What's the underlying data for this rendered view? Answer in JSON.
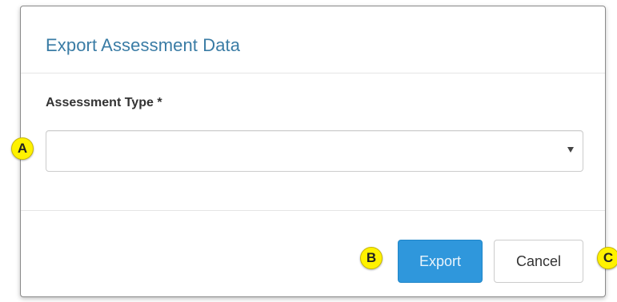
{
  "dialog": {
    "title": "Export Assessment Data",
    "field_label": "Assessment Type *",
    "select": {
      "value": "",
      "icon": "caret-down-icon"
    },
    "export_label": "Export",
    "cancel_label": "Cancel"
  },
  "callouts": {
    "a": "A",
    "b": "B",
    "c": "C"
  },
  "colors": {
    "title": "#3a7ca5",
    "primary_button": "#2f97dc",
    "callout": "#fff200"
  }
}
